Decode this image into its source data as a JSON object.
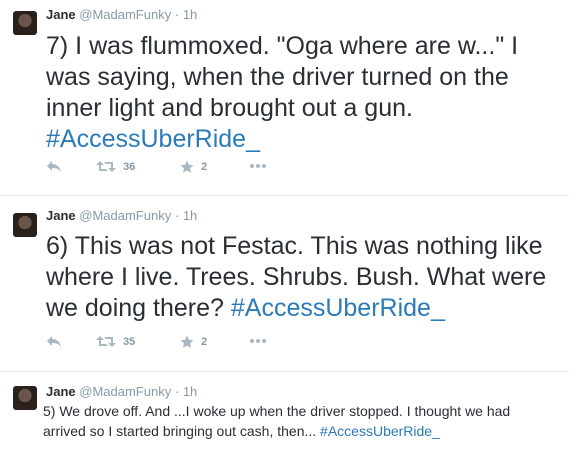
{
  "colors": {
    "text": "#292f33",
    "muted": "#8899a6",
    "hashtag": "#2b7bb9",
    "divider": "#e1e8ed"
  },
  "tweets": [
    {
      "name": "Jane",
      "handle": "@MadamFunky",
      "dot": "·",
      "time": "1h",
      "text_before": "7) I was flummoxed. \"Oga where are w...\" I was saying, when the driver turned on the inner light and brought out a gun. ",
      "hashtag": "#AccessUberRide_",
      "retweets": "36",
      "favorites": "2",
      "icons": [
        "reply-icon",
        "retweet-icon",
        "favorite-icon",
        "more-icon"
      ]
    },
    {
      "name": "Jane",
      "handle": "@MadamFunky",
      "dot": "·",
      "time": "1h",
      "text_before": "6) This was not Festac. This was nothing like where I live. Trees. Shrubs. Bush. What were we doing there? ",
      "hashtag": "#AccessUberRide_",
      "retweets": "35",
      "favorites": "2",
      "icons": [
        "reply-icon",
        "retweet-icon",
        "favorite-icon",
        "more-icon"
      ]
    },
    {
      "name": "Jane",
      "handle": "@MadamFunky",
      "dot": "·",
      "time": "1h",
      "text_before": "5) We drove off. And ...I woke up when the driver stopped. I thought we had arrived so I started bringing out cash, then... ",
      "hashtag": "#AccessUberRide_"
    }
  ]
}
